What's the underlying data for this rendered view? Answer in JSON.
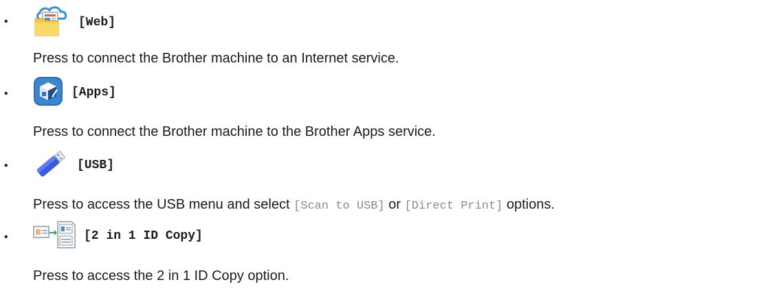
{
  "items": [
    {
      "label": "[Web]",
      "icon": "web-folder-cloud-icon",
      "description": "Press to connect the Brother machine to an Internet service."
    },
    {
      "label": "[Apps]",
      "icon": "apps-cube-icon",
      "description": "Press to connect the Brother machine to the Brother Apps service."
    },
    {
      "label": "[USB]",
      "icon": "usb-drive-icon",
      "description_parts": {
        "before": "Press to access the USB menu and select ",
        "option1": "[Scan to USB]",
        "middle": " or ",
        "option2": "[Direct Print]",
        "after": " options."
      }
    },
    {
      "label": "[2 in 1 ID Copy]",
      "icon": "id-copy-icon",
      "description": "Press to access the 2 in 1 ID Copy option."
    }
  ],
  "bullet": "•"
}
